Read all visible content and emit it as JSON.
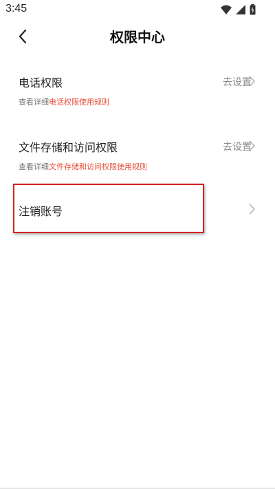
{
  "status_bar": {
    "time": "3:45",
    "icons": [
      "wifi-icon",
      "signal-icon",
      "battery-icon"
    ]
  },
  "header": {
    "back_icon": "chevron-left-icon",
    "title": "权限中心"
  },
  "permissions": [
    {
      "name": "电话权限",
      "action": "去设置",
      "desc_prefix": "查看详细",
      "desc_link": "电话权限使用规则"
    },
    {
      "name": "文件存储和访问权限",
      "action": "去设置",
      "desc_prefix": "查看详细",
      "desc_link": "文件存储和访问权限使用规则"
    }
  ],
  "cancel_account": {
    "label": "注销账号"
  },
  "colors": {
    "accent_link": "#e8503a",
    "highlight_border": "#d62020",
    "muted_text": "#8a8a8a"
  }
}
